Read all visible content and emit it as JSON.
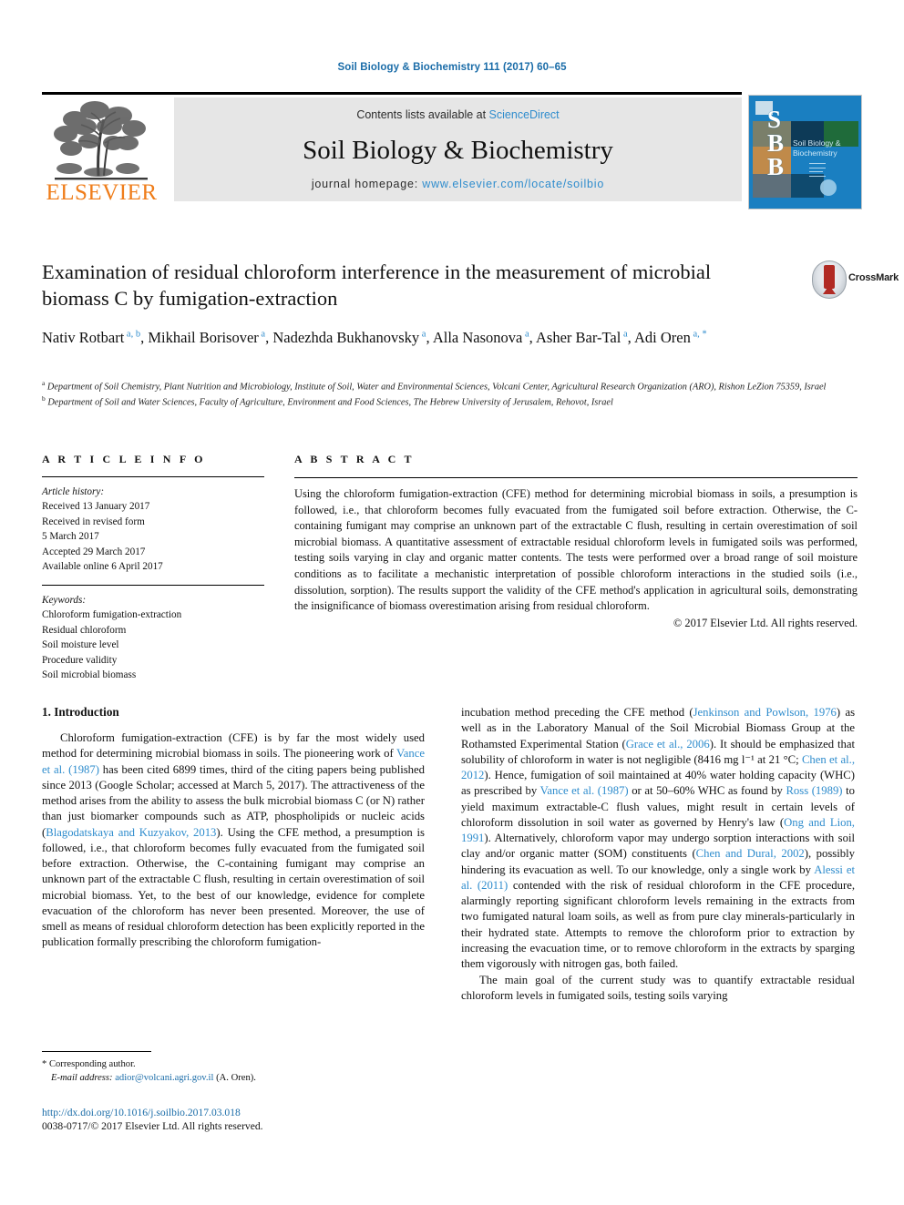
{
  "running_head": "Soil Biology & Biochemistry 111 (2017) 60–65",
  "masthead": {
    "publisher_name": "ELSEVIER",
    "contents_prefix": "Contents lists available at ",
    "contents_link": "ScienceDirect",
    "journal_title": "Soil Biology & Biochemistry",
    "homepage_prefix": "journal homepage: ",
    "homepage_url": "www.elsevier.com/locate/soilbio",
    "cover": {
      "letters": "S\nB\nB",
      "title_line1": "Soil Biology &",
      "title_line2": "Biochemistry"
    }
  },
  "article": {
    "title": "Examination of residual chloroform interference in the measurement of microbial biomass C by fumigation-extraction",
    "crossmark_label": "CrossMark",
    "authors": [
      {
        "name": "Nativ Rotbart",
        "marks": "a, b"
      },
      {
        "name": "Mikhail Borisover",
        "marks": "a"
      },
      {
        "name": "Nadezhda Bukhanovsky",
        "marks": "a"
      },
      {
        "name": "Alla Nasonova",
        "marks": "a"
      },
      {
        "name": "Asher Bar-Tal",
        "marks": "a"
      },
      {
        "name": "Adi Oren",
        "marks": "a, *"
      }
    ],
    "affiliations": [
      {
        "mark": "a",
        "text": "Department of Soil Chemistry, Plant Nutrition and Microbiology, Institute of Soil, Water and Environmental Sciences, Volcani Center, Agricultural Research Organization (ARO), Rishon LeZion 75359, Israel"
      },
      {
        "mark": "b",
        "text": "Department of Soil and Water Sciences, Faculty of Agriculture, Environment and Food Sciences, The Hebrew University of Jerusalem, Rehovot, Israel"
      }
    ]
  },
  "article_info": {
    "heading": "A R T I C L E   I N F O",
    "history_label": "Article history:",
    "history": [
      "Received 13 January 2017",
      "Received in revised form",
      "5 March 2017",
      "Accepted 29 March 2017",
      "Available online 6 April 2017"
    ],
    "keywords_label": "Keywords:",
    "keywords": [
      "Chloroform fumigation-extraction",
      "Residual chloroform",
      "Soil moisture level",
      "Procedure validity",
      "Soil microbial biomass"
    ]
  },
  "abstract": {
    "heading": "A B S T R A C T",
    "text": "Using the chloroform fumigation-extraction (CFE) method for determining microbial biomass in soils, a presumption is followed, i.e., that chloroform becomes fully evacuated from the fumigated soil before extraction. Otherwise, the C-containing fumigant may comprise an unknown part of the extractable C flush, resulting in certain overestimation of soil microbial biomass. A quantitative assessment of extractable residual chloroform levels in fumigated soils was performed, testing soils varying in clay and organic matter contents. The tests were performed over a broad range of soil moisture conditions as to facilitate a mechanistic interpretation of possible chloroform interactions in the studied soils (i.e., dissolution, sorption). The results support the validity of the CFE method's application in agricultural soils, demonstrating the insignificance of biomass overestimation arising from residual chloroform.",
    "copyright": "© 2017 Elsevier Ltd. All rights reserved."
  },
  "introduction": {
    "heading": "1. Introduction",
    "left_paragraph_1": {
      "segments": [
        {
          "t": "Chloroform fumigation-extraction (CFE) is by far the most widely used method for determining microbial biomass in soils. The pioneering work of "
        },
        {
          "t": "Vance et al. (1987)",
          "ref": true
        },
        {
          "t": " has been cited 6899 times, third of the citing papers being published since 2013 (Google Scholar; accessed at March 5, 2017). The attractiveness of the method arises from the ability to assess the bulk microbial biomass C (or N) rather than just biomarker compounds such as ATP, phospholipids or nucleic acids ("
        },
        {
          "t": "Blagodatskaya and Kuzyakov, 2013",
          "ref": true
        },
        {
          "t": "). Using the CFE method, a presumption is followed, i.e., that chloroform becomes fully evacuated from the fumigated soil before extraction. Otherwise, the C-containing fumigant may comprise an unknown part of the extractable C flush, resulting in certain overestimation of soil microbial biomass. Yet, to the best of our knowledge, evidence for complete evacuation of the chloroform has never been presented. Moreover, the use of smell as means of residual chloroform detection has been explicitly reported in the publication formally prescribing the chloroform fumigation-"
        }
      ]
    },
    "right_paragraph_1": {
      "segments": [
        {
          "t": "incubation method preceding the CFE method ("
        },
        {
          "t": "Jenkinson and Powlson, 1976",
          "ref": true
        },
        {
          "t": ") as well as in the Laboratory Manual of the Soil Microbial Biomass Group at the Rothamsted Experimental Station ("
        },
        {
          "t": "Grace et al., 2006",
          "ref": true
        },
        {
          "t": "). It should be emphasized that solubility of chloroform in water is not negligible (8416 mg l⁻¹ at 21 °C; "
        },
        {
          "t": "Chen et al., 2012",
          "ref": true
        },
        {
          "t": "). Hence, fumigation of soil maintained at 40% water holding capacity (WHC) as prescribed by "
        },
        {
          "t": "Vance et al. (1987)",
          "ref": true
        },
        {
          "t": " or at 50–60% WHC as found by "
        },
        {
          "t": "Ross (1989)",
          "ref": true
        },
        {
          "t": " to yield maximum extractable-C flush values, might result in certain levels of chloroform dissolution in soil water as governed by Henry's law ("
        },
        {
          "t": "Ong and Lion, 1991",
          "ref": true
        },
        {
          "t": "). Alternatively, chloroform vapor may undergo sorption interactions with soil clay and/or organic matter (SOM) constituents ("
        },
        {
          "t": "Chen and Dural, 2002",
          "ref": true
        },
        {
          "t": "), possibly hindering its evacuation as well. To our knowledge, only a single work by "
        },
        {
          "t": "Alessi et al. (2011)",
          "ref": true
        },
        {
          "t": " contended with the risk of residual chloroform in the CFE procedure, alarmingly reporting significant chloroform levels remaining in the extracts from two fumigated natural loam soils, as well as from pure clay minerals-particularly in their hydrated state. Attempts to remove the chloroform prior to extraction by increasing the evacuation time, or to remove chloroform in the extracts by sparging them vigorously with nitrogen gas, both failed."
        }
      ]
    },
    "right_paragraph_2": {
      "segments": [
        {
          "t": "The main goal of the current study was to quantify extractable residual chloroform levels in fumigated soils, testing soils varying"
        }
      ]
    }
  },
  "footnote": {
    "corresponding": "* Corresponding author.",
    "email_label": "E-mail address:",
    "email": "adior@volcani.agri.gov.il",
    "email_suffix": " (A. Oren)."
  },
  "footer": {
    "doi": "http://dx.doi.org/10.1016/j.soilbio.2017.03.018",
    "issn_line": "0038-0717/© 2017 Elsevier Ltd. All rights reserved."
  },
  "colors": {
    "link": "#2e8ccd",
    "running_head": "#1a6ca8",
    "elsevier_orange": "#ef7d1a",
    "cover_blue": "#1a7fc1",
    "crossmark_red": "#b12a24"
  }
}
